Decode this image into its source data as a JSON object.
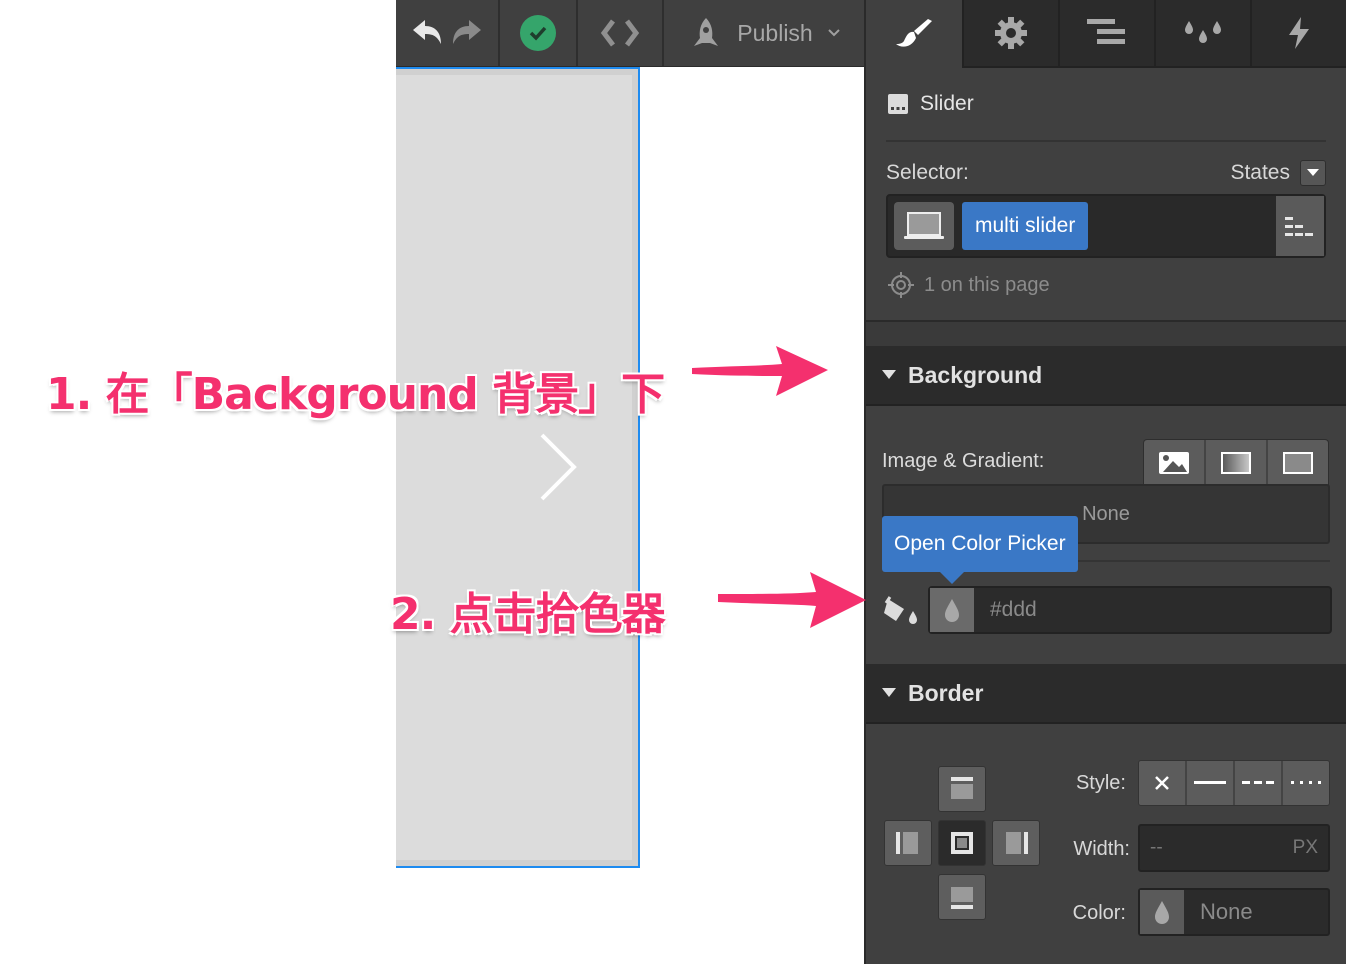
{
  "toolbar": {
    "undo_icon": "undo-icon",
    "redo_icon": "redo-icon",
    "status_icon": "check-circle-icon",
    "code_icon": "code-icon",
    "publish_label": "Publish"
  },
  "panel_tabs": [
    {
      "name": "style",
      "icon": "paintbrush-icon",
      "active": true
    },
    {
      "name": "settings",
      "icon": "gear-icon",
      "active": false
    },
    {
      "name": "navigator",
      "icon": "navigator-icon",
      "active": false
    },
    {
      "name": "swatches",
      "icon": "drops-icon",
      "active": false
    },
    {
      "name": "interactions",
      "icon": "lightning-icon",
      "active": false
    }
  ],
  "element": {
    "type_label": "Slider"
  },
  "selector": {
    "label": "Selector:",
    "states_label": "States",
    "class_name": "multi slider",
    "count_text": "1 on this page"
  },
  "background": {
    "title": "Background",
    "image_gradient_label": "Image & Gradient:",
    "image_gradient_value": "None",
    "tooltip": "Open Color Picker",
    "color_value": "#ddd"
  },
  "border": {
    "title": "Border",
    "style_label": "Style:",
    "width_label": "Width:",
    "width_placeholder": "--",
    "width_unit": "PX",
    "color_label": "Color:",
    "color_value": "None"
  },
  "annotations": {
    "step1": "1. 在「Background 背景」下",
    "step2": "2. 点击拾色器"
  },
  "colors": {
    "accent_blue": "#3a78c6",
    "selection_blue": "#1e8bf0",
    "success_green": "#35a56b",
    "annotation_pink": "#f4306e",
    "slider_bg": "#dddddd"
  }
}
